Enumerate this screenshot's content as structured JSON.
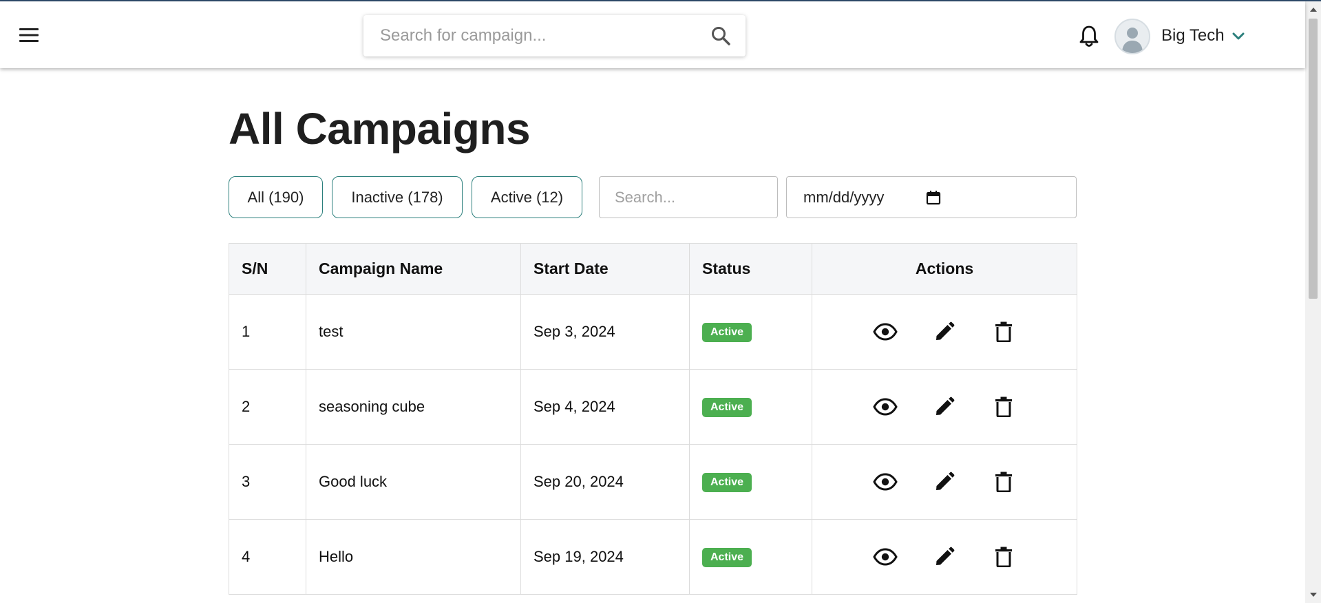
{
  "header": {
    "search_placeholder": "Search for campaign...",
    "user_name": "Big Tech",
    "icons": [
      "menu-icon",
      "search-icon",
      "bell-icon",
      "avatar-icon",
      "chevron-down-icon"
    ]
  },
  "page": {
    "title": "All Campaigns"
  },
  "filters": {
    "all_label": "All (190)",
    "inactive_label": "Inactive (178)",
    "active_label": "Active (12)",
    "search_placeholder": "Search...",
    "date_placeholder": "mm/dd/yyyy"
  },
  "table": {
    "columns": [
      "S/N",
      "Campaign Name",
      "Start Date",
      "Status",
      "Actions"
    ],
    "rows": [
      {
        "sn": "1",
        "name": "test",
        "start_date": "Sep 3, 2024",
        "status": "Active"
      },
      {
        "sn": "2",
        "name": "seasoning cube",
        "start_date": "Sep 4, 2024",
        "status": "Active"
      },
      {
        "sn": "3",
        "name": "Good luck",
        "start_date": "Sep 20, 2024",
        "status": "Active"
      },
      {
        "sn": "4",
        "name": "Hello",
        "start_date": "Sep 19, 2024",
        "status": "Active"
      }
    ]
  },
  "colors": {
    "accent_teal": "#2b7f7c",
    "active_badge": "#4caf50",
    "top_bar": "#2e4a6a"
  }
}
